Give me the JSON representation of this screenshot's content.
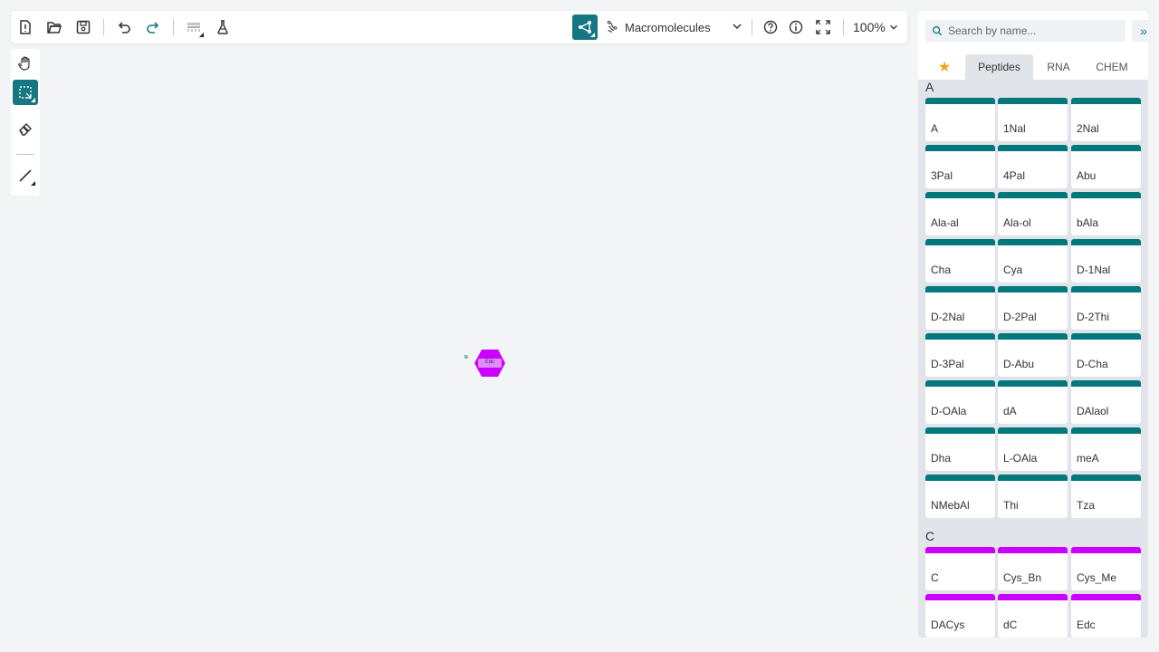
{
  "toolbar": {
    "mode": {
      "label": "Macromolecules"
    },
    "zoom": {
      "label": "100%"
    }
  },
  "canvas": {
    "monomer": {
      "label": "Edc",
      "attachment_label": "N",
      "color": "#cc00ff"
    }
  },
  "library": {
    "search": {
      "placeholder": "Search by name..."
    },
    "collapse_label": "»",
    "tabs": [
      {
        "label": "★"
      },
      {
        "label": "Peptides"
      },
      {
        "label": "RNA"
      },
      {
        "label": "CHEM"
      }
    ],
    "groups": [
      {
        "title": "A",
        "color": "#00787c",
        "items": [
          "A",
          "1Nal",
          "2Nal",
          "3Pal",
          "4Pal",
          "Abu",
          "Ala-al",
          "Ala-ol",
          "bAla",
          "Cha",
          "Cya",
          "D-1Nal",
          "D-2Nal",
          "D-2Pal",
          "D-2Thi",
          "D-3Pal",
          "D-Abu",
          "D-Cha",
          "D-OAla",
          "dA",
          "DAlaol",
          "Dha",
          "L-OAla",
          "meA",
          "NMebAl",
          "Thi",
          "Tza"
        ]
      },
      {
        "title": "C",
        "color": "#cc00ff",
        "items": [
          "C",
          "Cys_Bn",
          "Cys_Me",
          "DACys",
          "dC",
          "Edc"
        ]
      }
    ]
  },
  "colors": {
    "accent": "#167782",
    "peptide_a": "#00787c",
    "peptide_c": "#cc00ff",
    "favorite": "#f2a31b"
  }
}
